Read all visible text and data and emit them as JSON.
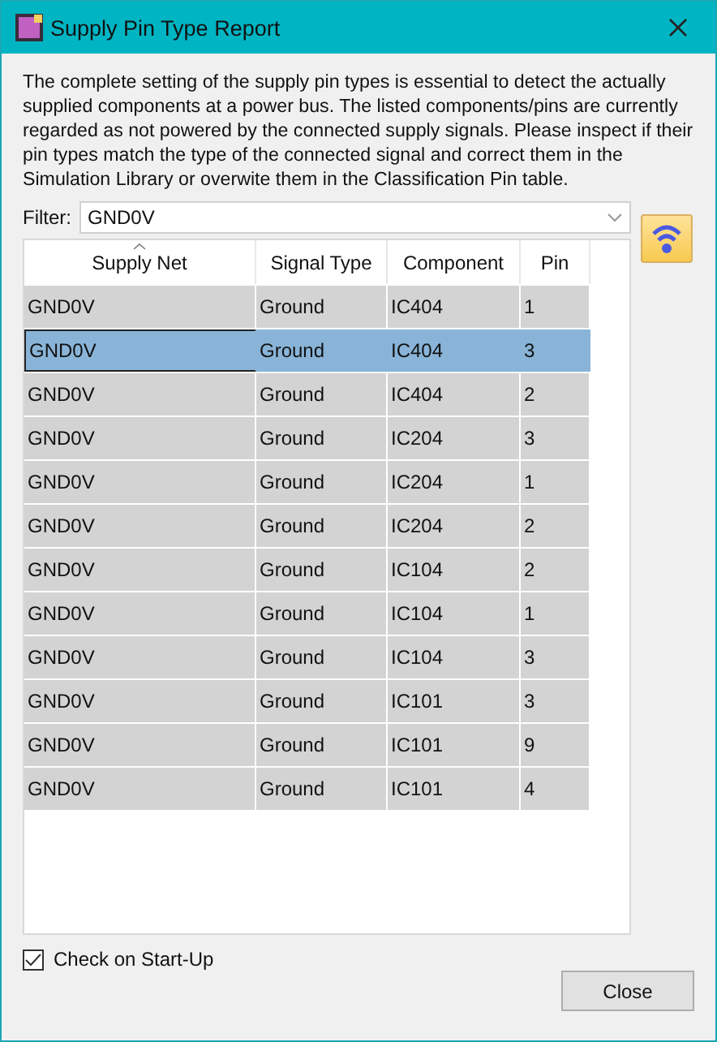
{
  "window": {
    "title": "Supply Pin Type Report"
  },
  "description": "The complete setting of the supply pin types is essential to detect the actually supplied components at a power bus. The listed components/pins are currently regarded as not powered by the connected supply signals. Please inspect if their pin types match the type of the connected signal and correct them in the Simulation Library or overwite them in the Classification Pin table.",
  "filter": {
    "label": "Filter:",
    "value": "GND0V"
  },
  "table": {
    "columns": [
      {
        "label": "Supply Net",
        "sorted": true
      },
      {
        "label": "Signal Type",
        "sorted": false
      },
      {
        "label": "Component",
        "sorted": false
      },
      {
        "label": "Pin",
        "sorted": false
      }
    ],
    "rows": [
      {
        "cells": [
          "GND0V",
          "Ground",
          "IC404",
          "1"
        ],
        "selected": false
      },
      {
        "cells": [
          "GND0V",
          "Ground",
          "IC404",
          "3"
        ],
        "selected": true
      },
      {
        "cells": [
          "GND0V",
          "Ground",
          "IC404",
          "2"
        ],
        "selected": false
      },
      {
        "cells": [
          "GND0V",
          "Ground",
          "IC204",
          "3"
        ],
        "selected": false
      },
      {
        "cells": [
          "GND0V",
          "Ground",
          "IC204",
          "1"
        ],
        "selected": false
      },
      {
        "cells": [
          "GND0V",
          "Ground",
          "IC204",
          "2"
        ],
        "selected": false
      },
      {
        "cells": [
          "GND0V",
          "Ground",
          "IC104",
          "2"
        ],
        "selected": false
      },
      {
        "cells": [
          "GND0V",
          "Ground",
          "IC104",
          "1"
        ],
        "selected": false
      },
      {
        "cells": [
          "GND0V",
          "Ground",
          "IC104",
          "3"
        ],
        "selected": false
      },
      {
        "cells": [
          "GND0V",
          "Ground",
          "IC101",
          "3"
        ],
        "selected": false
      },
      {
        "cells": [
          "GND0V",
          "Ground",
          "IC101",
          "9"
        ],
        "selected": false
      },
      {
        "cells": [
          "GND0V",
          "Ground",
          "IC101",
          "4"
        ],
        "selected": false
      }
    ]
  },
  "check_on_startup": {
    "label": "Check on Start-Up",
    "checked": true
  },
  "buttons": [
    {
      "label": "Close"
    }
  ]
}
